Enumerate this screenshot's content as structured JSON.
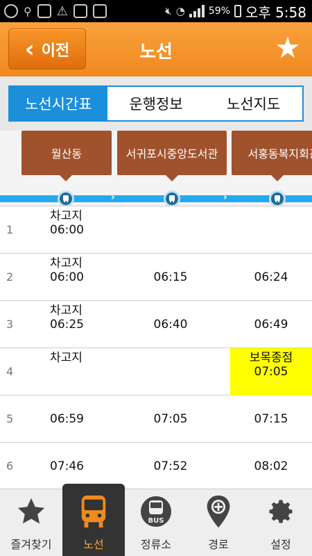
{
  "status_bar": {
    "battery_percent": "59%",
    "time": "오후 5:58"
  },
  "header": {
    "back_label": "이전",
    "title": "노선"
  },
  "tabs": [
    {
      "label": "노선시간표",
      "active": true
    },
    {
      "label": "운행정보",
      "active": false
    },
    {
      "label": "노선지도",
      "active": false
    }
  ],
  "stops": [
    "월산동",
    "서귀포시중앙도서관",
    "서홍동복지회관"
  ],
  "timetable": [
    {
      "num": "1",
      "c1": [
        "차고지",
        "06:00"
      ],
      "c2": "",
      "c3": ""
    },
    {
      "num": "2",
      "c1": [
        "차고지",
        "06:00"
      ],
      "c2": "06:15",
      "c3": "06:24"
    },
    {
      "num": "3",
      "c1": [
        "차고지",
        "06:25"
      ],
      "c2": "06:40",
      "c3": "06:49"
    },
    {
      "num": "4",
      "c1": [
        "차고지"
      ],
      "c2": "",
      "c3_top": "보목종점",
      "c3": "07:05",
      "c3_highlight": true
    },
    {
      "num": "5",
      "c1": [
        "06:59"
      ],
      "c2": "07:05",
      "c3": "07:15"
    },
    {
      "num": "6",
      "c1": [
        "07:46"
      ],
      "c2": "07:52",
      "c3": "08:02"
    }
  ],
  "bottom_nav": [
    {
      "label": "즐겨찾기",
      "icon": "star-icon"
    },
    {
      "label": "노선",
      "icon": "bus-icon",
      "active": true
    },
    {
      "label": "정류소",
      "icon": "bus-stop-icon"
    },
    {
      "label": "경로",
      "icon": "map-pin-icon"
    },
    {
      "label": "설정",
      "icon": "gear-icon"
    }
  ],
  "colors": {
    "accent": "#f08a1f",
    "tab_active": "#1b8fd9",
    "stop_brown": "#a0522d",
    "route_line": "#22aaee",
    "highlight": "#ffff00"
  }
}
